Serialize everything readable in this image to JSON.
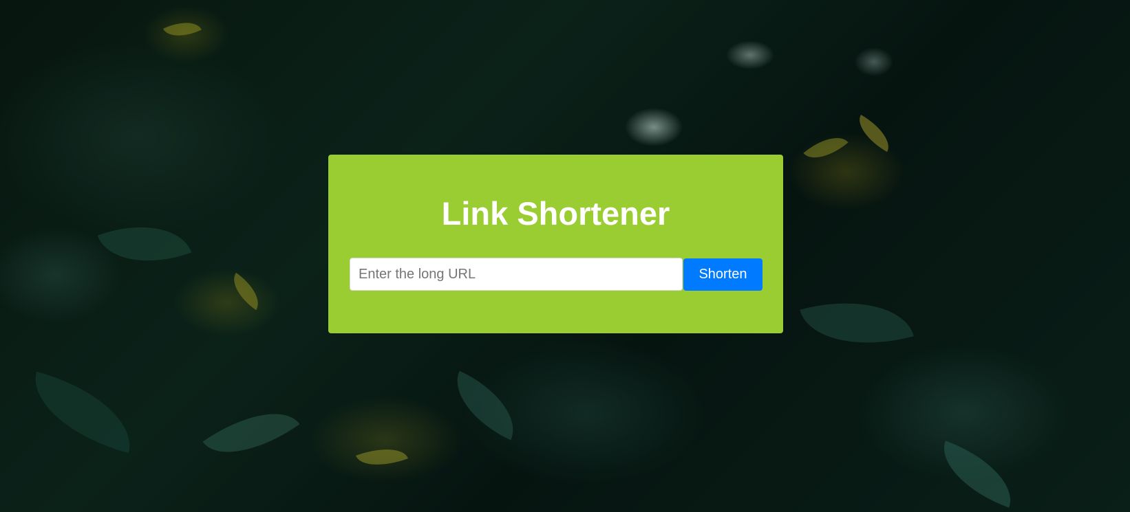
{
  "app": {
    "title": "Link Shortener"
  },
  "form": {
    "url_input": {
      "value": "",
      "placeholder": "Enter the long URL"
    },
    "submit_label": "Shorten"
  },
  "colors": {
    "card_background": "#9acd32",
    "button_background": "#007bff",
    "title_text": "#ffffff"
  }
}
